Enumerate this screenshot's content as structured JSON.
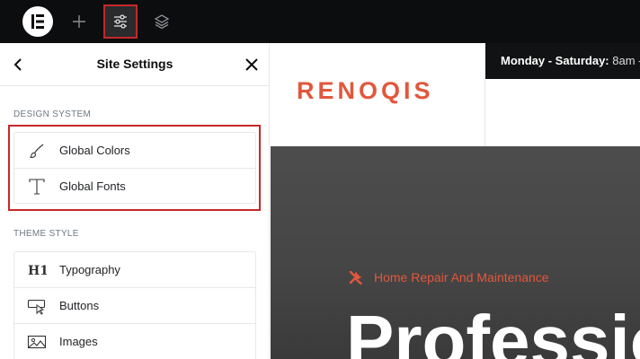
{
  "app": {
    "logo_icon": "elementor-logo-icon",
    "toolbar": {
      "add_icon": "plus-icon",
      "settings_icon": "sliders-icon",
      "layers_icon": "layers-icon"
    }
  },
  "panel": {
    "title": "Site Settings",
    "back_icon": "chevron-left-icon",
    "close_icon": "close-icon",
    "design_system": {
      "label": "DESIGN SYSTEM",
      "items": [
        {
          "label": "Global Colors",
          "icon": "brush-icon"
        },
        {
          "label": "Global Fonts",
          "icon": "font-t-icon"
        }
      ]
    },
    "theme_style": {
      "label": "THEME STYLE",
      "items": [
        {
          "label": "Typography",
          "icon": "h1-icon"
        },
        {
          "label": "Buttons",
          "icon": "button-cursor-icon"
        },
        {
          "label": "Images",
          "icon": "image-icon"
        }
      ]
    }
  },
  "preview": {
    "brand": "RENOQIS",
    "hours_label": "Monday - Saturday:",
    "hours_value": "8am -",
    "hero_tagline": "Home Repair And Maintenance",
    "hero_title": "Professio",
    "colors": {
      "brand": "#e2573c",
      "highlight": "#c62828"
    }
  }
}
